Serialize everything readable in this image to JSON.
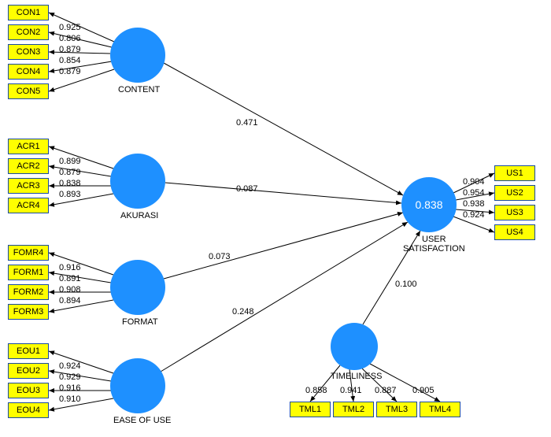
{
  "constructs": {
    "content": {
      "label": "CONTENT",
      "indicators": [
        {
          "name": "CON1",
          "loading": "0.925"
        },
        {
          "name": "CON2",
          "loading": "0.806"
        },
        {
          "name": "CON3",
          "loading": "0.879"
        },
        {
          "name": "CON4",
          "loading": "0.854"
        },
        {
          "name": "CON5",
          "loading": "0.879"
        }
      ]
    },
    "akurasi": {
      "label": "AKURASI",
      "indicators": [
        {
          "name": "ACR1",
          "loading": "0.899"
        },
        {
          "name": "ACR2",
          "loading": "0.879"
        },
        {
          "name": "ACR3",
          "loading": "0.838"
        },
        {
          "name": "ACR4",
          "loading": "0.893"
        }
      ]
    },
    "format": {
      "label": "FORMAT",
      "indicators": [
        {
          "name": "FOMR4",
          "loading": "0.916"
        },
        {
          "name": "FORM1",
          "loading": "0.891"
        },
        {
          "name": "FORM2",
          "loading": "0.908"
        },
        {
          "name": "FORM3",
          "loading": "0.894"
        }
      ]
    },
    "ease": {
      "label": "EASE OF USE",
      "indicators": [
        {
          "name": "EOU1",
          "loading": "0.924"
        },
        {
          "name": "EOU2",
          "loading": "0.929"
        },
        {
          "name": "EOU3",
          "loading": "0.916"
        },
        {
          "name": "EOU4",
          "loading": "0.910"
        }
      ]
    },
    "timeliness": {
      "label": "TIMELINESS",
      "indicators": [
        {
          "name": "TML1",
          "loading": "0.858"
        },
        {
          "name": "TML2",
          "loading": "0.941"
        },
        {
          "name": "TML3",
          "loading": "0.887"
        },
        {
          "name": "TML4",
          "loading": "0.905"
        }
      ]
    },
    "usersat": {
      "label": "USER\nSATISFACTION",
      "r2": "0.838",
      "indicators": [
        {
          "name": "US1",
          "loading": "0.904"
        },
        {
          "name": "US2",
          "loading": "0.954"
        },
        {
          "name": "US3",
          "loading": "0.938"
        },
        {
          "name": "US4",
          "loading": "0.924"
        }
      ]
    }
  },
  "paths": {
    "content_us": "0.471",
    "akurasi_us": "0.087",
    "format_us": "0.073",
    "ease_us": "0.248",
    "timeliness_us": "0.100"
  },
  "chart_data": {
    "type": "diagram",
    "model": "PLS-SEM",
    "latent_variables": [
      "CONTENT",
      "AKURASI",
      "FORMAT",
      "EASE OF USE",
      "TIMELINESS",
      "USER SATISFACTION"
    ],
    "endogenous": {
      "USER SATISFACTION": {
        "r2": 0.838
      }
    },
    "outer_loadings": {
      "CONTENT": {
        "CON1": 0.925,
        "CON2": 0.806,
        "CON3": 0.879,
        "CON4": 0.854,
        "CON5": 0.879
      },
      "AKURASI": {
        "ACR1": 0.899,
        "ACR2": 0.879,
        "ACR3": 0.838,
        "ACR4": 0.893
      },
      "FORMAT": {
        "FOMR4": 0.916,
        "FORM1": 0.891,
        "FORM2": 0.908,
        "FORM3": 0.894
      },
      "EASE OF USE": {
        "EOU1": 0.924,
        "EOU2": 0.929,
        "EOU3": 0.916,
        "EOU4": 0.91
      },
      "TIMELINESS": {
        "TML1": 0.858,
        "TML2": 0.941,
        "TML3": 0.887,
        "TML4": 0.905
      },
      "USER SATISFACTION": {
        "US1": 0.904,
        "US2": 0.954,
        "US3": 0.938,
        "US4": 0.924
      }
    },
    "path_coefficients": {
      "CONTENT -> USER SATISFACTION": 0.471,
      "AKURASI -> USER SATISFACTION": 0.087,
      "FORMAT -> USER SATISFACTION": 0.073,
      "EASE OF USE -> USER SATISFACTION": 0.248,
      "TIMELINESS -> USER SATISFACTION": 0.1
    }
  }
}
